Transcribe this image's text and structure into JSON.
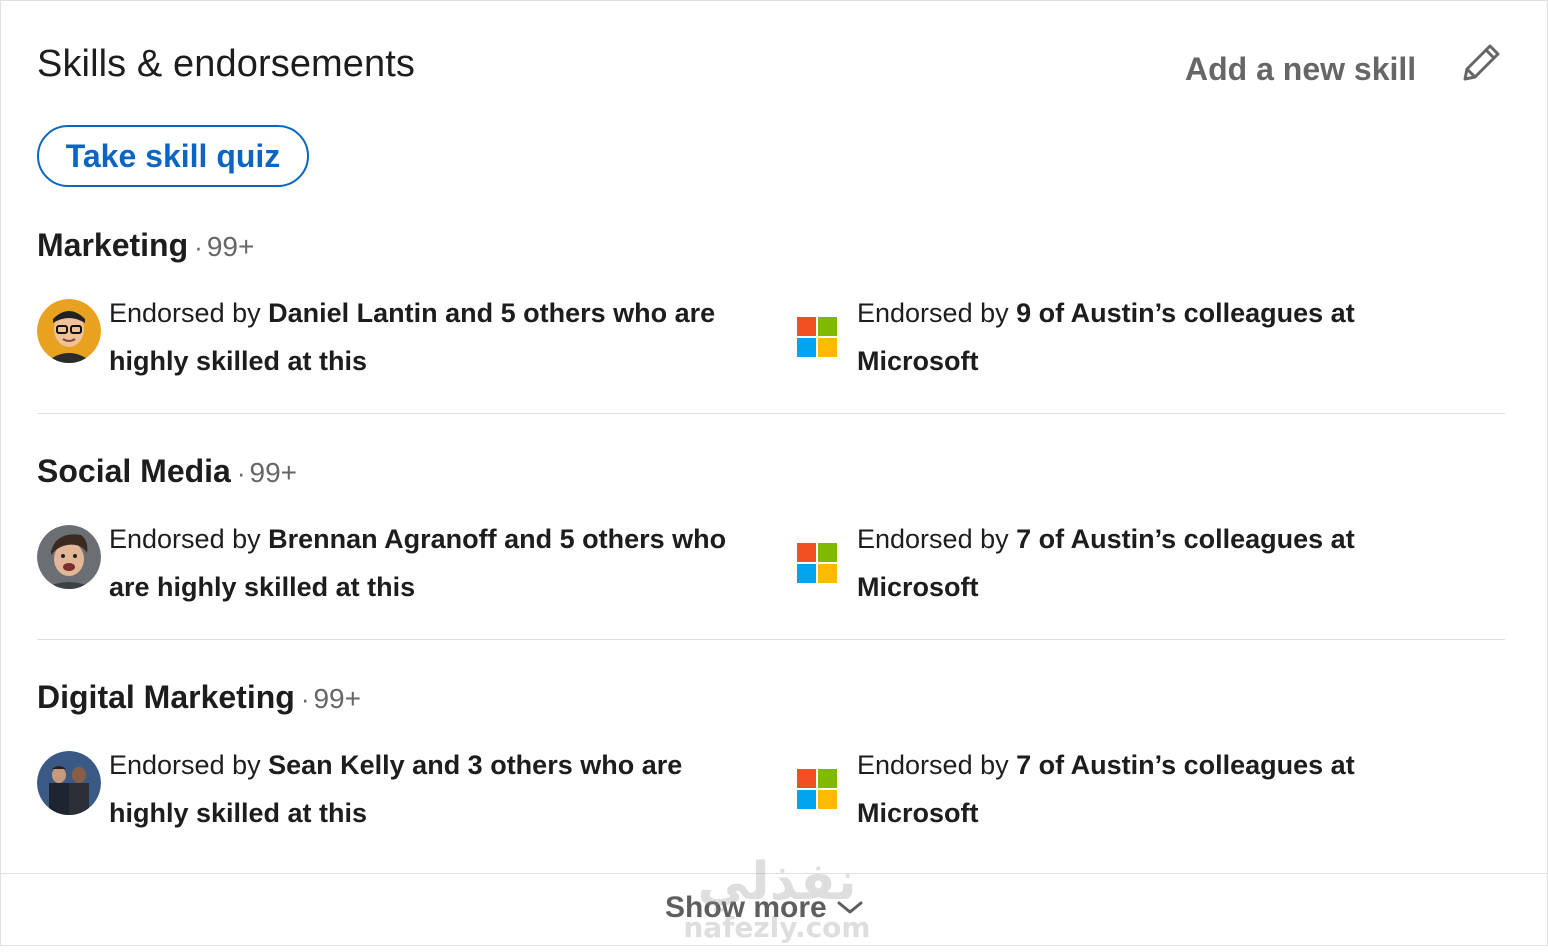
{
  "header": {
    "title": "Skills & endorsements",
    "add_skill_label": "Add a new skill"
  },
  "quiz_button_label": "Take skill quiz",
  "skills": [
    {
      "name": "Marketing",
      "count": "99+",
      "left_prefix": "Endorsed by ",
      "left_bold": "Daniel Lantin and 5 others who are highly skilled at this",
      "right_prefix": "Endorsed by ",
      "right_bold": "9 of Austin’s colleagues at Microsoft"
    },
    {
      "name": "Social Media",
      "count": "99+",
      "left_prefix": "Endorsed by ",
      "left_bold": "Brennan Agranoff and 5 others who are highly skilled at this",
      "right_prefix": "Endorsed by ",
      "right_bold": "7 of Austin’s colleagues at Microsoft"
    },
    {
      "name": "Digital Marketing",
      "count": "99+",
      "left_prefix": "Endorsed by ",
      "left_bold": "Sean Kelly and 3 others who are highly skilled at this",
      "right_prefix": "Endorsed by ",
      "right_bold": "7 of Austin’s colleagues at Microsoft"
    }
  ],
  "show_more_label": "Show more",
  "watermark": {
    "arabic": "نفذلي",
    "latin": "nafezly.com"
  },
  "colors": {
    "accent": "#0a66c2",
    "ms_red": "#f25022",
    "ms_green": "#7fba00",
    "ms_blue": "#00a4ef",
    "ms_yellow": "#ffb900"
  }
}
